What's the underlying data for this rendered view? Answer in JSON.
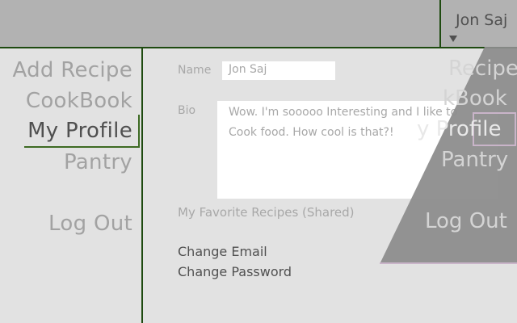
{
  "header": {
    "user_name": "Jon Saj"
  },
  "sidebar": {
    "items": [
      {
        "label": "Add Recipe"
      },
      {
        "label": "CookBook"
      },
      {
        "label": "My Profile"
      },
      {
        "label": "Pantry"
      },
      {
        "label": "Log Out"
      }
    ]
  },
  "profile": {
    "name_label": "Name",
    "name_value": "Jon Saj",
    "bio_label": "Bio",
    "bio_value": "Wow. I'm sooooo Interesting and I like to Cook food. How cool is that?!",
    "favorites_label": "My Favorite Recipes (Shared)",
    "change_email": "Change Email",
    "change_password": "Change Password"
  },
  "overlay_menu": {
    "items": [
      {
        "label": "Recipe"
      },
      {
        "label": "kBook"
      },
      {
        "label": "y Profile"
      },
      {
        "label": "Pantry"
      },
      {
        "label": "Log Out"
      }
    ]
  },
  "colors": {
    "topbar": "#b2b2b2",
    "background": "#e2e2e2",
    "accent_line": "#1e4a10",
    "overlay": "#8c8c8c"
  }
}
